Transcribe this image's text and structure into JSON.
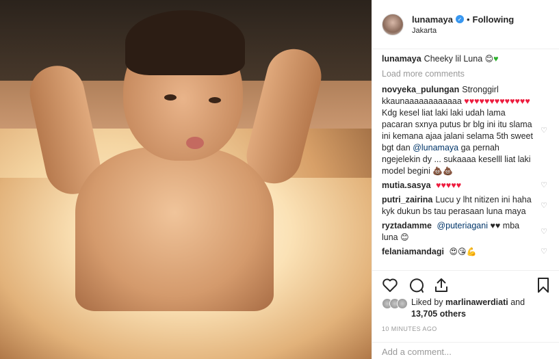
{
  "post": {
    "username": "lunamaya",
    "follow_state": "Following",
    "separator": "•",
    "location": "Jakarta"
  },
  "caption": {
    "user": "lunamaya",
    "text": "Cheeky lil Luna"
  },
  "load_more": "Load more comments",
  "comments": [
    {
      "user": "novyeka_pulungan",
      "text_a": "Stronggirl kkaunaaaaaaaaaaaa",
      "text_b": "Kdg kesel liat laki laki udah lama pacaran sxnya putus br blg ini itu slama ini kemana ajaa jalani selama 5th sweet bgt dan",
      "mention": "@lunamaya",
      "text_c": "ga pernah ngejelekin dy ... sukaaaa keselll liat laki model begini"
    },
    {
      "user": "mutia.sasya",
      "text_a": ""
    },
    {
      "user": "putri_zairina",
      "text_a": "Lucu y lht nitizen ini haha kyk dukun bs tau perasaan luna maya"
    },
    {
      "user": "ryztadamme",
      "mention": "@puteriagani",
      "text_a": "mba luna"
    },
    {
      "user": "felaniamandagi",
      "text_a": ""
    }
  ],
  "likes": {
    "prefix": "Liked by",
    "user": "marlinawerdiati",
    "and": "and",
    "count": "13,705 others"
  },
  "timestamp": "10 MINUTES AGO",
  "add_comment_placeholder": "Add a comment...",
  "icons": {
    "like": "heart-outline-icon",
    "comment": "comment-bubble-icon",
    "share": "share-arrow-icon",
    "save": "bookmark-icon"
  },
  "colors": {
    "accent": "#3897f0",
    "heart_red": "#ed1c3e"
  }
}
